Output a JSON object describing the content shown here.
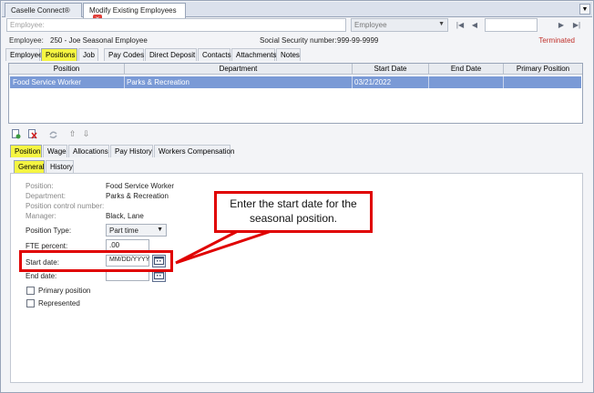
{
  "doc_tabs": [
    {
      "label": "Caselle Connect®"
    },
    {
      "label": "Modify Existing Employees",
      "close": "×"
    }
  ],
  "menu_arrow": "▼",
  "lookup": {
    "employee_placeholder": "Employee:",
    "search_by": "Employee",
    "nav_first": "|◀",
    "nav_prev": "◀",
    "nav_next": "▶",
    "nav_last": "▶|"
  },
  "employee_info": {
    "employee_label": "Employee:",
    "employee_value": "250 - Joe Seasonal Employee",
    "ssn_label": "Social Security number:",
    "ssn_value": "999-99-9999",
    "status": "Terminated"
  },
  "main_tabs": [
    "Employee",
    "Positions",
    "Job",
    "Pay Codes",
    "Direct Deposit",
    "Contacts",
    "Attachments",
    "Notes"
  ],
  "grid": {
    "columns": [
      "Position",
      "Department",
      "Start Date",
      "End Date",
      "Primary Position"
    ],
    "rows": [
      [
        "Food Service Worker",
        "Parks & Recreation",
        "03/21/2022",
        "",
        ""
      ]
    ]
  },
  "mini_toolbar": [
    "add-icon",
    "delete-icon",
    "link-icon",
    "arrow-up-icon",
    "arrow-down-icon"
  ],
  "sub_tabs": [
    "Position",
    "Wage",
    "Allocations",
    "Pay History",
    "Workers Compensation"
  ],
  "subsub_tabs": [
    "General",
    "History"
  ],
  "details": {
    "position_label": "Position:",
    "position_value": "Food Service Worker",
    "department_label": "Department:",
    "department_value": "Parks & Recreation",
    "control_label": "Position control number:",
    "manager_label": "Manager:",
    "manager_value": "Black, Lane",
    "position_type_label": "Position Type:",
    "position_type_value": "Part time",
    "fte_label": "FTE percent:",
    "fte_value": ".00",
    "start_label": "Start date:",
    "start_placeholder": "MM/DD/YYYY",
    "end_label": "End date:",
    "primary_label": "Primary position",
    "represented_label": "Represented"
  },
  "callout": "Enter the start date for the seasonal position.",
  "colors": {
    "highlight": "#f5f542",
    "callout_border": "#e00000",
    "selected_row": "#7a9ad6",
    "terminated": "#c0302a"
  }
}
